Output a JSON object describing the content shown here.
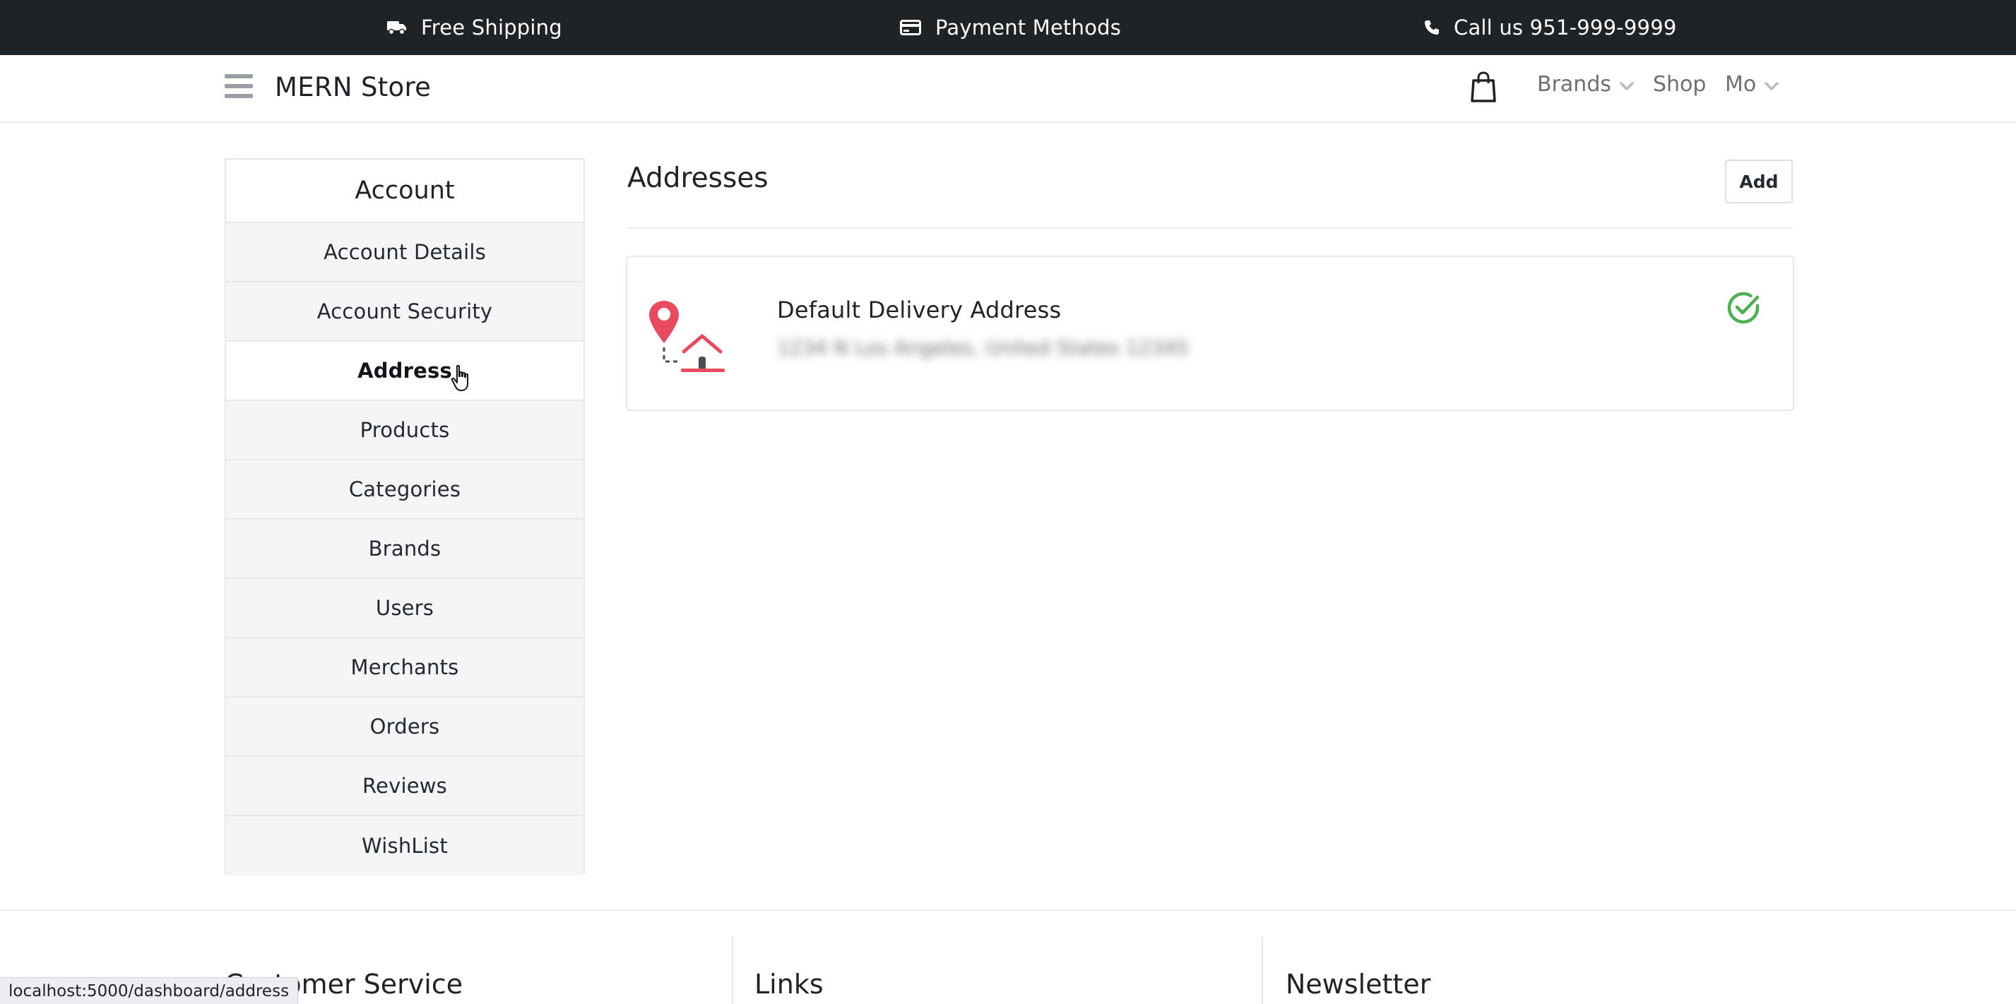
{
  "topbar": {
    "shipping": "Free Shipping",
    "shipping_icon": "truck-icon",
    "payment": "Payment Methods",
    "payment_icon": "credit-card-icon",
    "call": "Call us 951-999-9999",
    "call_icon": "phone-icon"
  },
  "header": {
    "logo": "MERN Store",
    "nav": {
      "cart_icon": "shopping-bag-icon",
      "brands": "Brands",
      "shop": "Shop",
      "user": "Mo"
    }
  },
  "sidebar": {
    "title": "Account",
    "items": [
      {
        "label": "Account Details"
      },
      {
        "label": "Account Security"
      },
      {
        "label": "Address"
      },
      {
        "label": "Products"
      },
      {
        "label": "Categories"
      },
      {
        "label": "Brands"
      },
      {
        "label": "Users"
      },
      {
        "label": "Merchants"
      },
      {
        "label": "Orders"
      },
      {
        "label": "Reviews"
      },
      {
        "label": "WishList"
      }
    ],
    "active": "Address"
  },
  "main": {
    "title": "Addresses",
    "add_label": "Add",
    "address_card": {
      "title": "Default Delivery Address",
      "text": "1234 N Los Angeles, United States 12345",
      "icon": "location-home-icon",
      "status_icon": "check-circle-icon"
    }
  },
  "footer": {
    "columns": [
      "Customer Service",
      "Links",
      "Newsletter"
    ]
  },
  "statusbar": {
    "url": "localhost:5000/dashboard/address"
  },
  "colors": {
    "topbar_bg": "#202326",
    "sidebar_bg": "#f4f5f7",
    "check_green": "#4caf50",
    "pin_red": "#e84a5f"
  }
}
